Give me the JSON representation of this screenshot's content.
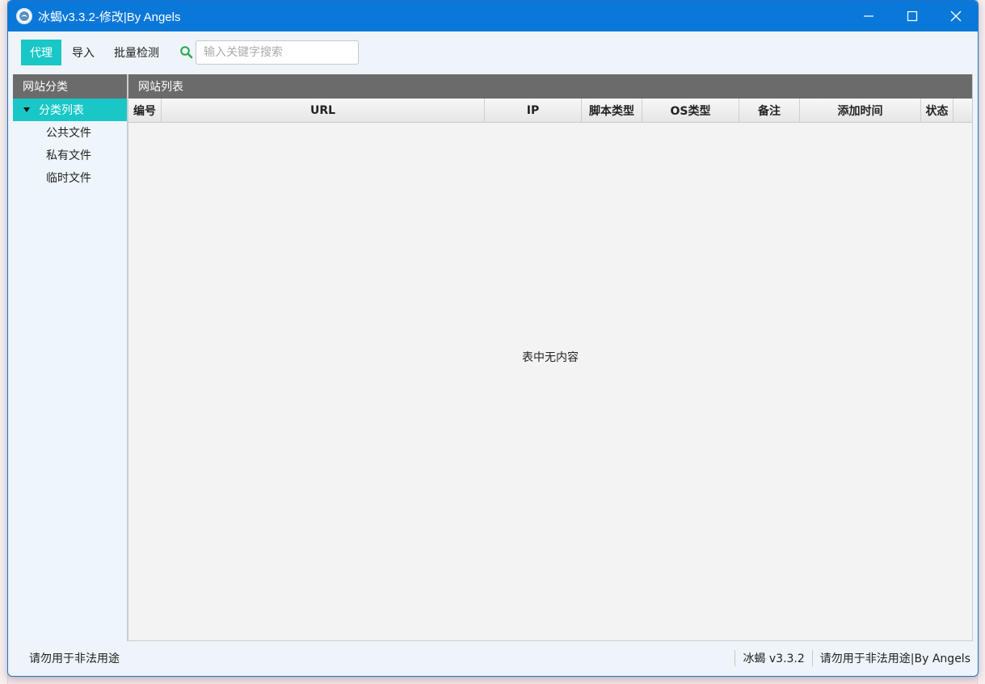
{
  "window": {
    "title": "冰蝎v3.3.2-修改|By Angels"
  },
  "toolbar": {
    "items": [
      {
        "label": "代理",
        "active": true
      },
      {
        "label": "导入",
        "active": false
      },
      {
        "label": "批量检测",
        "active": false
      }
    ],
    "search_placeholder": "输入关键字搜索"
  },
  "left_panel": {
    "header": "网站分类",
    "root": "分类列表",
    "children": [
      "公共文件",
      "私有文件",
      "临时文件"
    ]
  },
  "right_panel": {
    "header": "网站列表",
    "columns": [
      "编号",
      "URL",
      "IP",
      "脚本类型",
      "OS类型",
      "备注",
      "添加时间",
      "状态"
    ],
    "empty_message": "表中无内容"
  },
  "statusbar": {
    "left": "请勿用于非法用途",
    "version": "冰蝎 v3.3.2",
    "right": "请勿用于非法用途|By Angels"
  },
  "colors": {
    "titlebar": "#0a78d8",
    "accent": "#19c7c7",
    "panel_header": "#6b6b6b"
  }
}
